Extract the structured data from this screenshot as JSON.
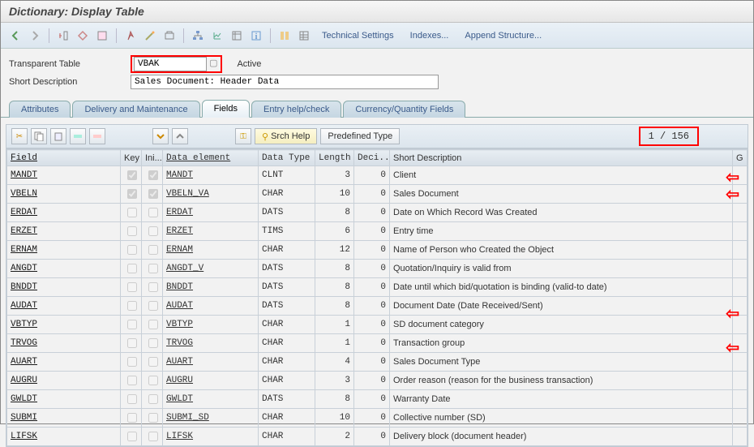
{
  "title": "Dictionary: Display Table",
  "toolbar_links": {
    "tech": "Technical Settings",
    "indexes": "Indexes...",
    "append": "Append Structure..."
  },
  "form": {
    "table_label": "Transparent Table",
    "table_value": "VBAK",
    "status": "Active",
    "desc_label": "Short Description",
    "desc_value": "Sales Document: Header Data"
  },
  "tabs": {
    "attributes": "Attributes",
    "delivery": "Delivery and Maintenance",
    "fields": "Fields",
    "entry": "Entry help/check",
    "currency": "Currency/Quantity Fields"
  },
  "inner": {
    "srch": "Srch Help",
    "predefined": "Predefined Type",
    "page": "1 / 156"
  },
  "columns": {
    "field": "Field",
    "key": "Key",
    "ini": "Ini...",
    "de": "Data element",
    "dt": "Data Type",
    "len": "Length",
    "dec": "Deci...",
    "sd": "Short Description",
    "g": "G"
  },
  "rows": [
    {
      "field": "MANDT",
      "key": true,
      "ini": true,
      "de": "MANDT",
      "dt": "CLNT",
      "len": "3",
      "dec": "0",
      "sd": "Client",
      "arrow": true
    },
    {
      "field": "VBELN",
      "key": true,
      "ini": true,
      "de": "VBELN_VA",
      "dt": "CHAR",
      "len": "10",
      "dec": "0",
      "sd": "Sales Document",
      "arrow": true
    },
    {
      "field": "ERDAT",
      "key": false,
      "ini": false,
      "de": "ERDAT",
      "dt": "DATS",
      "len": "8",
      "dec": "0",
      "sd": "Date on Which Record Was Created"
    },
    {
      "field": "ERZET",
      "key": false,
      "ini": false,
      "de": "ERZET",
      "dt": "TIMS",
      "len": "6",
      "dec": "0",
      "sd": "Entry time"
    },
    {
      "field": "ERNAM",
      "key": false,
      "ini": false,
      "de": "ERNAM",
      "dt": "CHAR",
      "len": "12",
      "dec": "0",
      "sd": "Name of Person who Created the Object"
    },
    {
      "field": "ANGDT",
      "key": false,
      "ini": false,
      "de": "ANGDT_V",
      "dt": "DATS",
      "len": "8",
      "dec": "0",
      "sd": "Quotation/Inquiry is valid from"
    },
    {
      "field": "BNDDT",
      "key": false,
      "ini": false,
      "de": "BNDDT",
      "dt": "DATS",
      "len": "8",
      "dec": "0",
      "sd": "Date until which bid/quotation is binding (valid-to date)"
    },
    {
      "field": "AUDAT",
      "key": false,
      "ini": false,
      "de": "AUDAT",
      "dt": "DATS",
      "len": "8",
      "dec": "0",
      "sd": "Document Date (Date Received/Sent)"
    },
    {
      "field": "VBTYP",
      "key": false,
      "ini": false,
      "de": "VBTYP",
      "dt": "CHAR",
      "len": "1",
      "dec": "0",
      "sd": "SD document category",
      "arrow": true
    },
    {
      "field": "TRVOG",
      "key": false,
      "ini": false,
      "de": "TRVOG",
      "dt": "CHAR",
      "len": "1",
      "dec": "0",
      "sd": "Transaction group"
    },
    {
      "field": "AUART",
      "key": false,
      "ini": false,
      "de": "AUART",
      "dt": "CHAR",
      "len": "4",
      "dec": "0",
      "sd": "Sales Document Type",
      "arrow": true
    },
    {
      "field": "AUGRU",
      "key": false,
      "ini": false,
      "de": "AUGRU",
      "dt": "CHAR",
      "len": "3",
      "dec": "0",
      "sd": "Order reason (reason for the business transaction)"
    },
    {
      "field": "GWLDT",
      "key": false,
      "ini": false,
      "de": "GWLDT",
      "dt": "DATS",
      "len": "8",
      "dec": "0",
      "sd": "Warranty Date"
    },
    {
      "field": "SUBMI",
      "key": false,
      "ini": false,
      "de": "SUBMI_SD",
      "dt": "CHAR",
      "len": "10",
      "dec": "0",
      "sd": "Collective number (SD)"
    },
    {
      "field": "LIFSK",
      "key": false,
      "ini": false,
      "de": "LIFSK",
      "dt": "CHAR",
      "len": "2",
      "dec": "0",
      "sd": "Delivery block (document header)"
    }
  ]
}
